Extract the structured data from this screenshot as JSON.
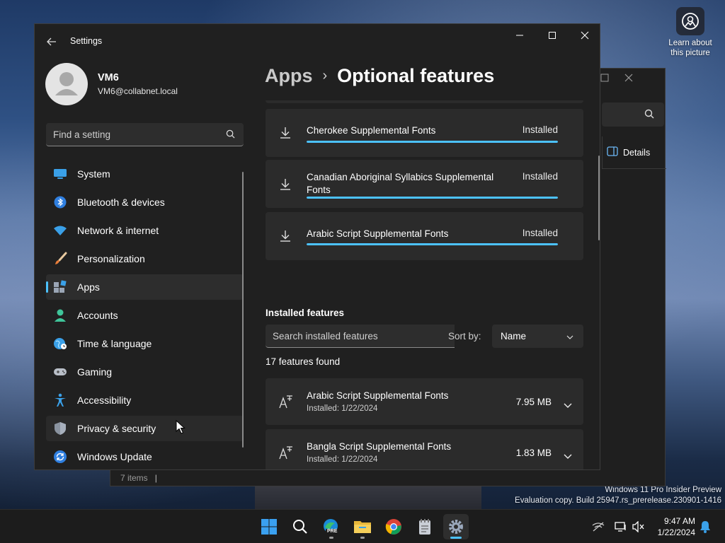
{
  "desktop": {
    "learn_widget_text": "Learn about this picture",
    "watermark": {
      "line1": "Windows 11 Pro Insider Preview",
      "line2": "Evaluation copy. Build 25947.rs_prerelease.230901-1416"
    }
  },
  "background_window": {
    "details_label": "Details",
    "status_text": "7 items",
    "status_sep": "|"
  },
  "settings": {
    "title": "Settings",
    "user": {
      "name": "VM6",
      "email": "VM6@collabnet.local"
    },
    "search": {
      "placeholder": "Find a setting",
      "value": ""
    },
    "nav": [
      {
        "label": "System",
        "icon": "system-icon",
        "selected": false
      },
      {
        "label": "Bluetooth & devices",
        "icon": "bluetooth-icon",
        "selected": false
      },
      {
        "label": "Network & internet",
        "icon": "wifi-icon",
        "selected": false
      },
      {
        "label": "Personalization",
        "icon": "brush-icon",
        "selected": false
      },
      {
        "label": "Apps",
        "icon": "apps-icon",
        "selected": true
      },
      {
        "label": "Accounts",
        "icon": "accounts-icon",
        "selected": false
      },
      {
        "label": "Time & language",
        "icon": "globe-icon",
        "selected": false
      },
      {
        "label": "Gaming",
        "icon": "gamepad-icon",
        "selected": false
      },
      {
        "label": "Accessibility",
        "icon": "accessibility-icon",
        "selected": false
      },
      {
        "label": "Privacy & security",
        "icon": "shield-icon",
        "selected": false
      },
      {
        "label": "Windows Update",
        "icon": "update-icon",
        "selected": false
      }
    ],
    "breadcrumb": {
      "parent": "Apps",
      "separator": "›",
      "current": "Optional features"
    },
    "downloads": [
      {
        "name": "Cherokee Supplemental Fonts",
        "status": "Installed",
        "progress": 1.0
      },
      {
        "name": "Canadian Aboriginal Syllabics Supplemental Fonts",
        "status": "Installed",
        "progress": 1.0
      },
      {
        "name": "Arabic Script Supplemental Fonts",
        "status": "Installed",
        "progress": 1.0
      }
    ],
    "installed": {
      "title": "Installed features",
      "search_placeholder": "Search installed features",
      "sort_label": "Sort by:",
      "sort_value": "Name",
      "count_text": "17 features found",
      "items": [
        {
          "name": "Arabic Script Supplemental Fonts",
          "date": "Installed: 1/22/2024",
          "size": "7.95 MB"
        },
        {
          "name": "Bangla Script Supplemental Fonts",
          "date": "Installed: 1/22/2024",
          "size": "1.83 MB"
        }
      ]
    }
  },
  "taskbar": {
    "apps": [
      {
        "name": "start-button",
        "active": false,
        "running": false
      },
      {
        "name": "search-button",
        "active": false,
        "running": false
      },
      {
        "name": "edge-preview-app",
        "active": false,
        "running": true
      },
      {
        "name": "file-explorer-app",
        "active": false,
        "running": true
      },
      {
        "name": "chrome-app",
        "active": false,
        "running": false
      },
      {
        "name": "notepad-app",
        "active": false,
        "running": false
      },
      {
        "name": "settings-app",
        "active": true,
        "running": true
      }
    ],
    "edge_badge": "PRE",
    "time": "9:47 AM",
    "date": "1/22/2024"
  },
  "colors": {
    "accent": "#4cc2ff",
    "window_bg": "#202020",
    "card_bg": "#2b2b2b"
  }
}
